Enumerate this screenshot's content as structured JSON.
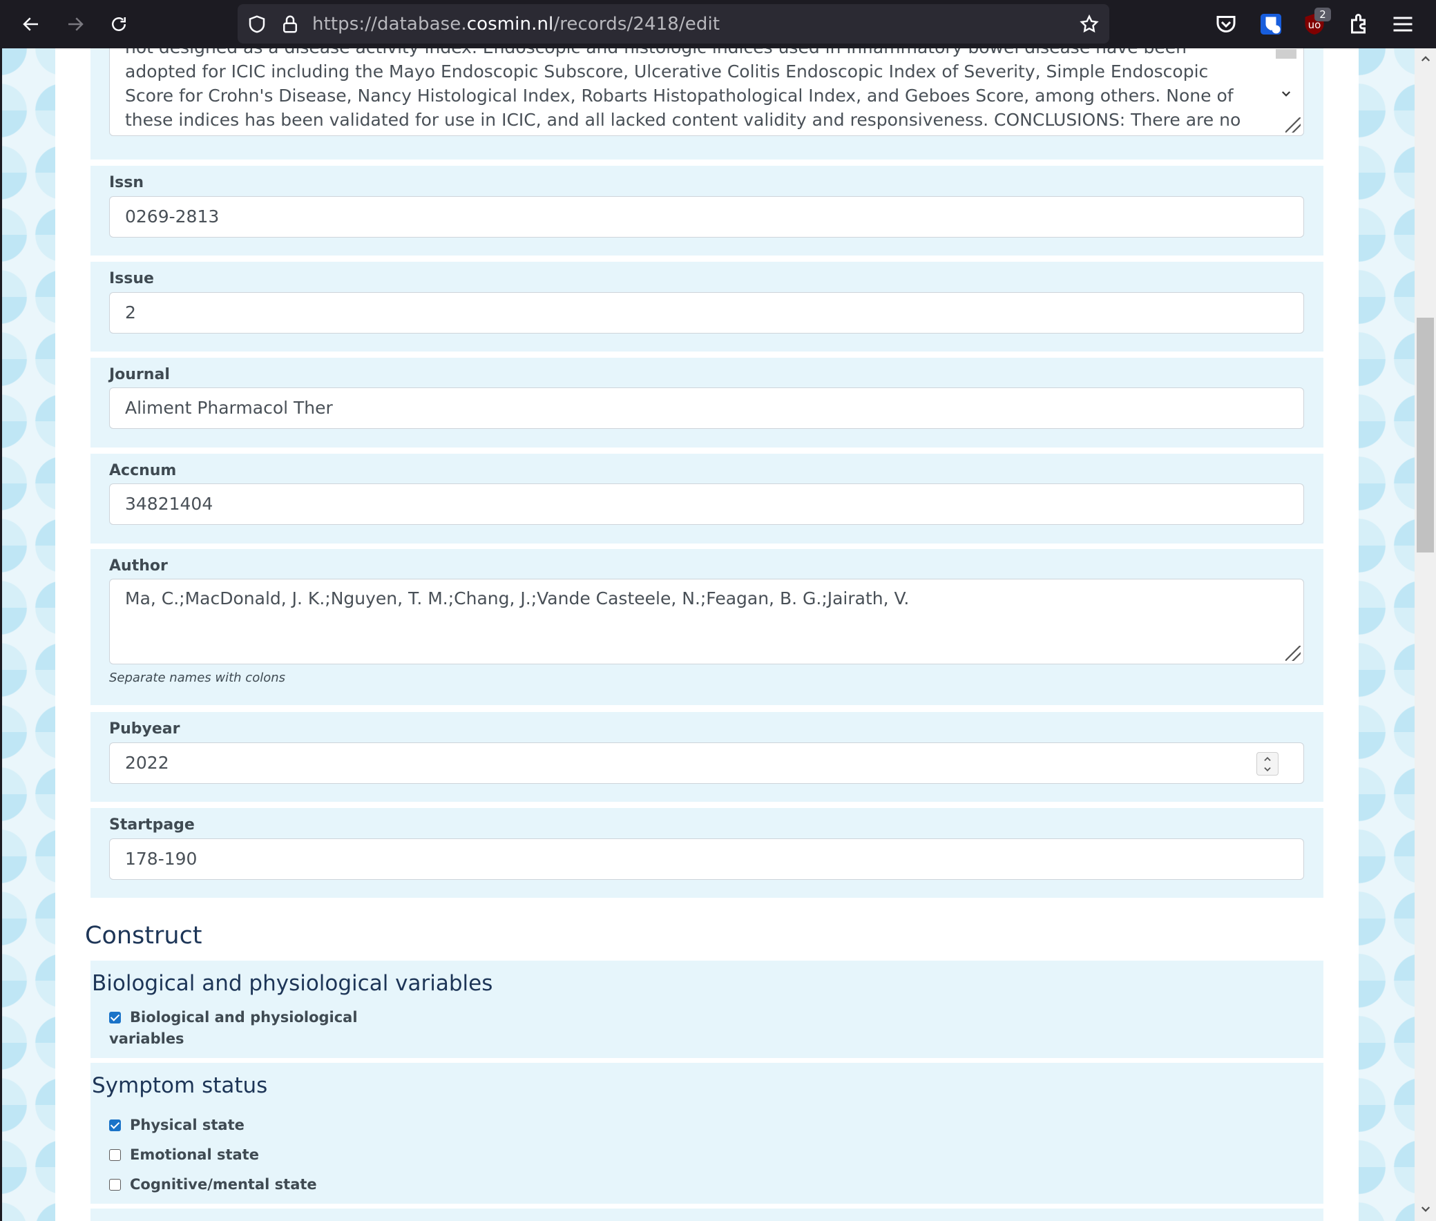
{
  "browser": {
    "url_prefix": "https://database.",
    "url_domain": "cosmin.nl",
    "url_path": "/records/2418/edit",
    "extension_badge": "2"
  },
  "abstract": {
    "text": "not designed as a disease activity index. Endoscopic and histologic indices used in inflammatory bowel disease have been adopted for ICIC including the Mayo Endoscopic Subscore, Ulcerative Colitis Endoscopic Index of Severity, Simple Endoscopic Score for Crohn's Disease, Nancy Histological Index, Robarts Histopathological Index, and Geboes Score, among others. None of these indices has been validated for use in ICIC, and all lacked content validity and responsiveness. CONCLUSIONS: There are no validated clinical, endoscopic, or histologic outcomes to assess"
  },
  "fields": {
    "issn": {
      "label": "Issn",
      "value": "0269-2813"
    },
    "issue": {
      "label": "Issue",
      "value": "2"
    },
    "journal": {
      "label": "Journal",
      "value": "Aliment Pharmacol Ther"
    },
    "accnum": {
      "label": "Accnum",
      "value": "34821404"
    },
    "author": {
      "label": "Author",
      "value": "Ma, C.;MacDonald, J. K.;Nguyen, T. M.;Chang, J.;Vande Casteele, N.;Feagan, B. G.;Jairath, V.",
      "help": "Separate names with colons"
    },
    "pubyear": {
      "label": "Pubyear",
      "value": "2022"
    },
    "startpage": {
      "label": "Startpage",
      "value": "178-190"
    }
  },
  "construct": {
    "title": "Construct",
    "groups": [
      {
        "title": "Biological and physiological variables",
        "items": [
          {
            "label_line1": "Biological and physiological",
            "label_line2": "variables",
            "checked": true
          }
        ]
      },
      {
        "title": "Symptom status",
        "items": [
          {
            "label": "Physical state",
            "checked": true
          },
          {
            "label": "Emotional state",
            "checked": false
          },
          {
            "label": "Cognitive/mental state",
            "checked": false
          }
        ]
      }
    ]
  },
  "colors": {
    "card_bg": "#e6f5fb",
    "heading": "#1d3557",
    "checkbox_on": "#1a73c8"
  }
}
